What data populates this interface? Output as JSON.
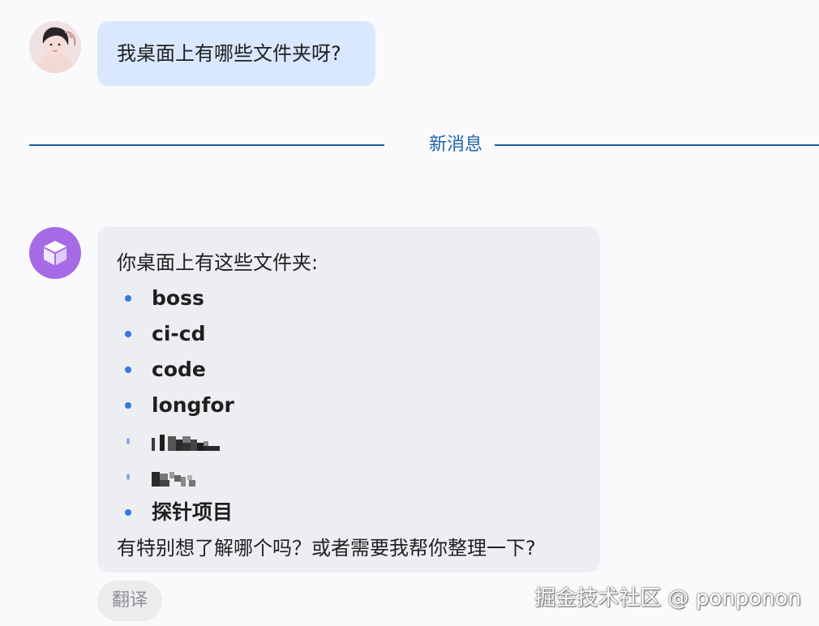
{
  "conversation": {
    "user_message": {
      "avatar_icon": "user-avatar-portrait",
      "text": "我桌面上有哪些文件夹呀?"
    },
    "divider": {
      "label": "新消息",
      "line_color": "#1e5d99"
    },
    "assistant_message": {
      "avatar_icon": "cube-icon",
      "avatar_color": "#a56be6",
      "intro": "你桌面上有这些文件夹:",
      "folders": [
        {
          "label": "boss"
        },
        {
          "label": "ci-cd"
        },
        {
          "label": "code"
        },
        {
          "label": "longfor"
        },
        {
          "label": "",
          "redacted": true
        },
        {
          "label": "",
          "redacted": true
        },
        {
          "label": "探针项目"
        }
      ],
      "outro": "有特别想了解哪个吗？或者需要我帮你整理一下?"
    },
    "actions": {
      "translate_label": "翻译"
    }
  },
  "watermark": "掘金技术社区 @ ponponon",
  "colors": {
    "user_bubble": "#d9e7ff",
    "assistant_bubble": "#eceef2",
    "bullet": "#3478e6"
  }
}
